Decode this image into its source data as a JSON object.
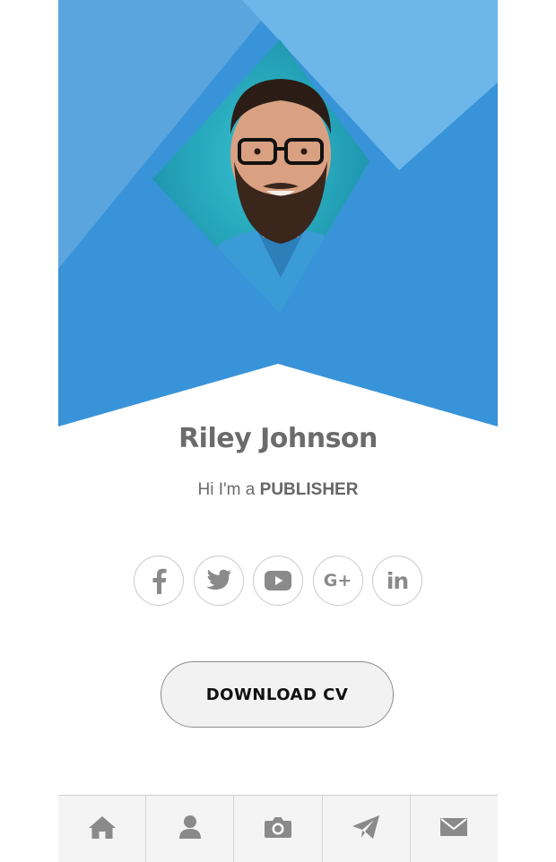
{
  "profile": {
    "name": "Riley Johnson",
    "greeting": "Hi I'm a ",
    "role": "PUBLISHER"
  },
  "social": [
    {
      "icon": "facebook-icon",
      "glyph": "f"
    },
    {
      "icon": "twitter-icon"
    },
    {
      "icon": "youtube-icon"
    },
    {
      "icon": "google-plus-icon",
      "glyph": "G+"
    },
    {
      "icon": "linkedin-icon",
      "glyph": "in"
    }
  ],
  "cta": {
    "label": "DOWNLOAD CV"
  },
  "tabs": [
    {
      "icon": "home-icon"
    },
    {
      "icon": "user-icon"
    },
    {
      "icon": "camera-icon"
    },
    {
      "icon": "send-icon"
    },
    {
      "icon": "mail-icon"
    }
  ],
  "colors": {
    "hero_dark": "#3993d8",
    "hero_mid": "#5aa5de",
    "hero_light": "#6cb6ea",
    "photo_bg": "#1e9fb3",
    "icon_gray": "#8a8a8a",
    "text_gray": "#6b6b6b"
  }
}
